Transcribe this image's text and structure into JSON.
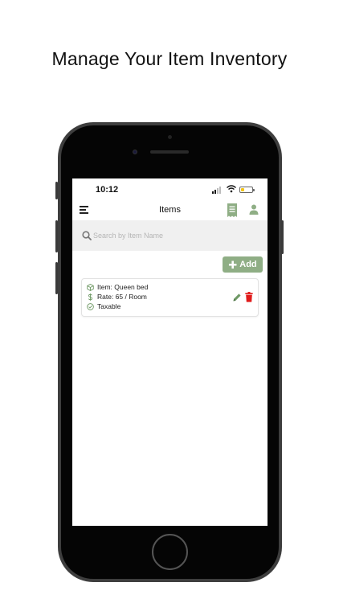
{
  "headline": "Manage Your Item Inventory",
  "status_bar": {
    "time": "10:12"
  },
  "nav": {
    "title": "Items"
  },
  "search": {
    "placeholder": "Search by Item Name",
    "value": ""
  },
  "add_button": {
    "label": "Add"
  },
  "items": [
    {
      "name_line": "Item: Queen bed",
      "rate_line": "Rate: 65 / Room",
      "tax_line": "Taxable"
    }
  ],
  "colors": {
    "accent_green": "#8fae85",
    "delete_red": "#e01b1b",
    "search_bg": "#f0f0f0"
  },
  "icons": [
    "menu-icon",
    "receipt-icon",
    "person-icon",
    "search-icon",
    "box-icon",
    "dollar-icon",
    "check-circle-icon",
    "pencil-icon",
    "trash-icon"
  ]
}
